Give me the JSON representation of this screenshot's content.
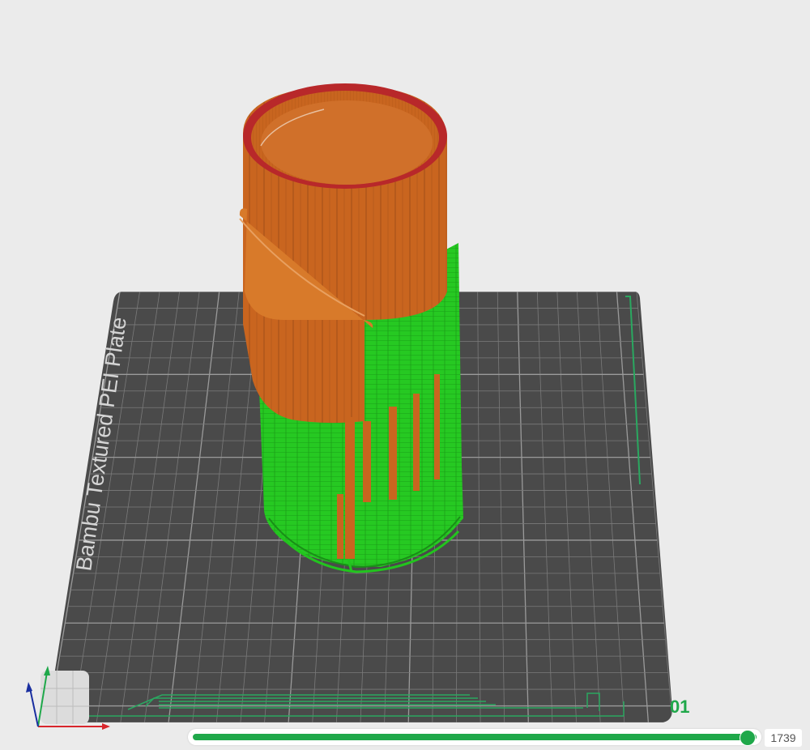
{
  "plate": {
    "name": "Bambu Textured PEI Plate",
    "plate_number": "01"
  },
  "layer_slider": {
    "current_layer": "1739",
    "fill_fraction": 1.0
  },
  "colors": {
    "background": "#ebebeb",
    "plate": "#4a4a4a",
    "grid": "#8a8a8a",
    "model_upper": "#c9651f",
    "model_lower": "#22c41e",
    "model_rim": "#b8282a",
    "accent": "#1fa84a"
  },
  "axes": {
    "x_color": "#d8262c",
    "y_color": "#1fa84a",
    "z_color": "#1a2fa0"
  }
}
